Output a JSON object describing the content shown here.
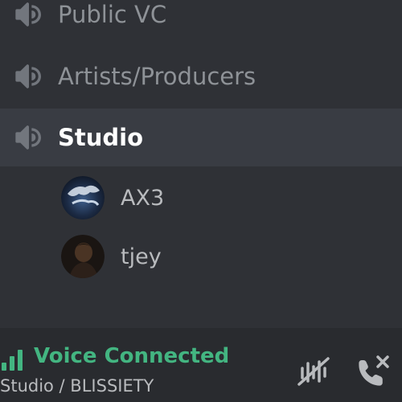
{
  "channels": [
    {
      "label": "Public VC",
      "icon": "speaker-icon",
      "active": false
    },
    {
      "label": "Artists/Producers",
      "icon": "speaker-icon",
      "active": false
    },
    {
      "label": "Studio",
      "icon": "speaker-icon",
      "active": true
    }
  ],
  "voice_users": [
    {
      "name": "AX3",
      "avatar": "avatar"
    },
    {
      "name": "tjey",
      "avatar": "avatar"
    }
  ],
  "voice_panel": {
    "status": "Voice Connected",
    "channel_server": "Studio / BLISSIETY",
    "status_color": "#43b581",
    "icons": [
      "signal-icon",
      "noise-suppression-icon",
      "disconnect-icon"
    ]
  },
  "colors": {
    "background": "#2f3136",
    "active_channel_bg": "#393c43",
    "panel_bg": "#292b2f"
  }
}
